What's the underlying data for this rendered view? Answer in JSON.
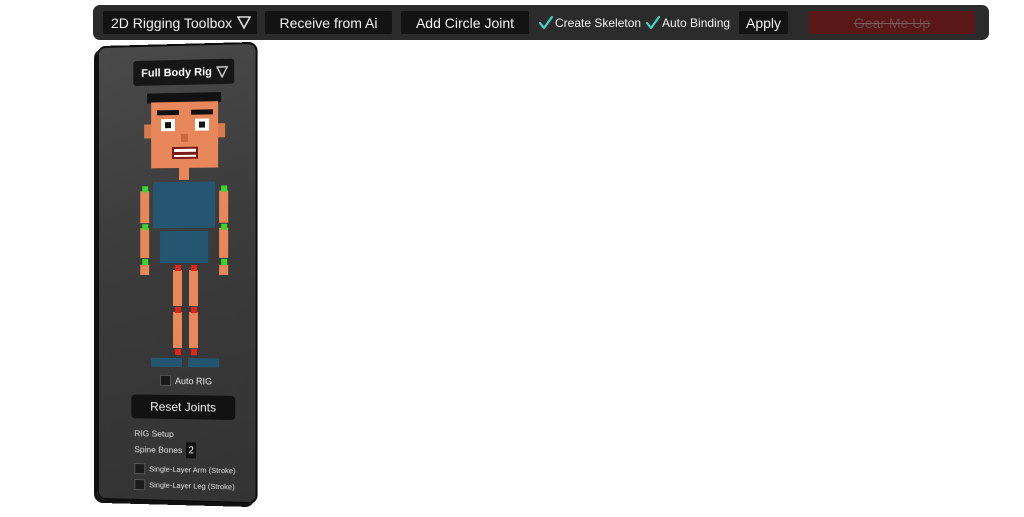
{
  "toolbar": {
    "dropdown_label": "2D Rigging Toolbox",
    "receive_label": "Receive from Ai",
    "add_circle_label": "Add Circle Joint",
    "create_skeleton_label": "Create Skeleton",
    "create_skeleton_checked": true,
    "auto_binding_label": "Auto Binding",
    "auto_binding_checked": true,
    "apply_label": "Apply",
    "gear_label": "Gear Me Up"
  },
  "panel": {
    "rig_dropdown_label": "Full Body Rig",
    "auto_rig_label": "Auto RIG",
    "auto_rig_checked": false,
    "reset_label": "Reset Joints",
    "rig_setup_label": "RIG Setup",
    "spine_bones_label": "Spine Bones",
    "spine_bones_value": "2",
    "single_layer_arm_label": "Single-Layer Arm (Stroke)",
    "single_layer_arm_checked": false,
    "single_layer_leg_label": "Single-Layer Leg (Stroke)",
    "single_layer_leg_checked": false
  },
  "colors": {
    "toolbar_bg": "#2b2b2b",
    "button_bg": "#131313",
    "check_accent": "#3fd4c4",
    "gear_bg": "#5a1717",
    "skin": "#e8885a",
    "shirt": "#245672",
    "joint_arm": "#39d62d",
    "joint_leg": "#e2231a"
  }
}
